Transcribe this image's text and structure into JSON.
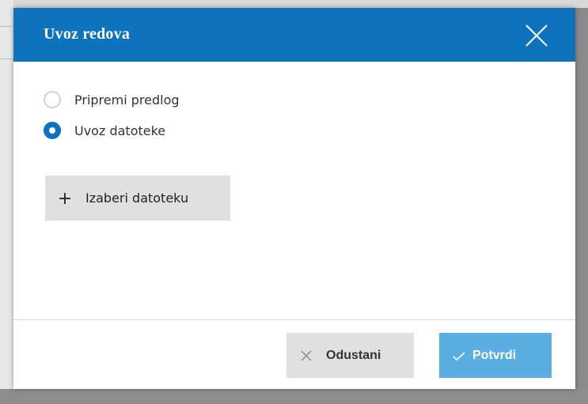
{
  "dialog": {
    "title": "Uvoz redova",
    "close_icon": "close-icon",
    "options": [
      {
        "label": "Pripremi predlog",
        "selected": false
      },
      {
        "label": "Uvoz datoteke",
        "selected": true
      }
    ],
    "choose_file": {
      "label": "Izaberi datoteku",
      "icon": "plus-icon"
    },
    "footer": {
      "cancel_label": "Odustani",
      "cancel_icon": "x-icon",
      "confirm_label": "Potvrdi",
      "confirm_icon": "check-icon"
    }
  },
  "colors": {
    "header": "#0f72bc",
    "radio_selected": "#0f72bc",
    "confirm_button": "#5aaee2",
    "secondary_button": "#e0e0e0"
  }
}
